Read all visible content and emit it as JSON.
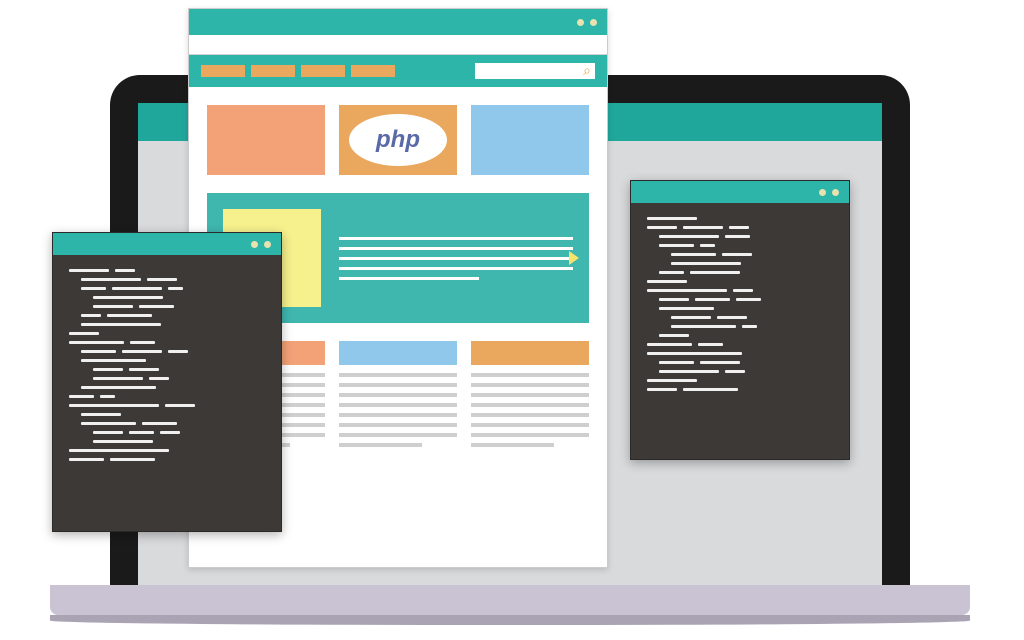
{
  "laptop": {
    "screen_accent": "#1fa79b"
  },
  "browser": {
    "nav_items": [
      "",
      "",
      "",
      ""
    ],
    "search_placeholder": "",
    "cards": {
      "php_label": "php"
    },
    "hero": {
      "line_count": 5
    },
    "footer": {
      "columns": 3,
      "lines_per_col": 8
    }
  },
  "code_windows": {
    "left": {
      "lines": 22
    },
    "right": {
      "lines": 20
    }
  },
  "colors": {
    "teal": "#2db5a9",
    "orange": "#e9a85e",
    "salmon": "#f3a278",
    "skyblue": "#8fc8ea",
    "yellow": "#f6f08d",
    "charcoal": "#3d3936"
  }
}
